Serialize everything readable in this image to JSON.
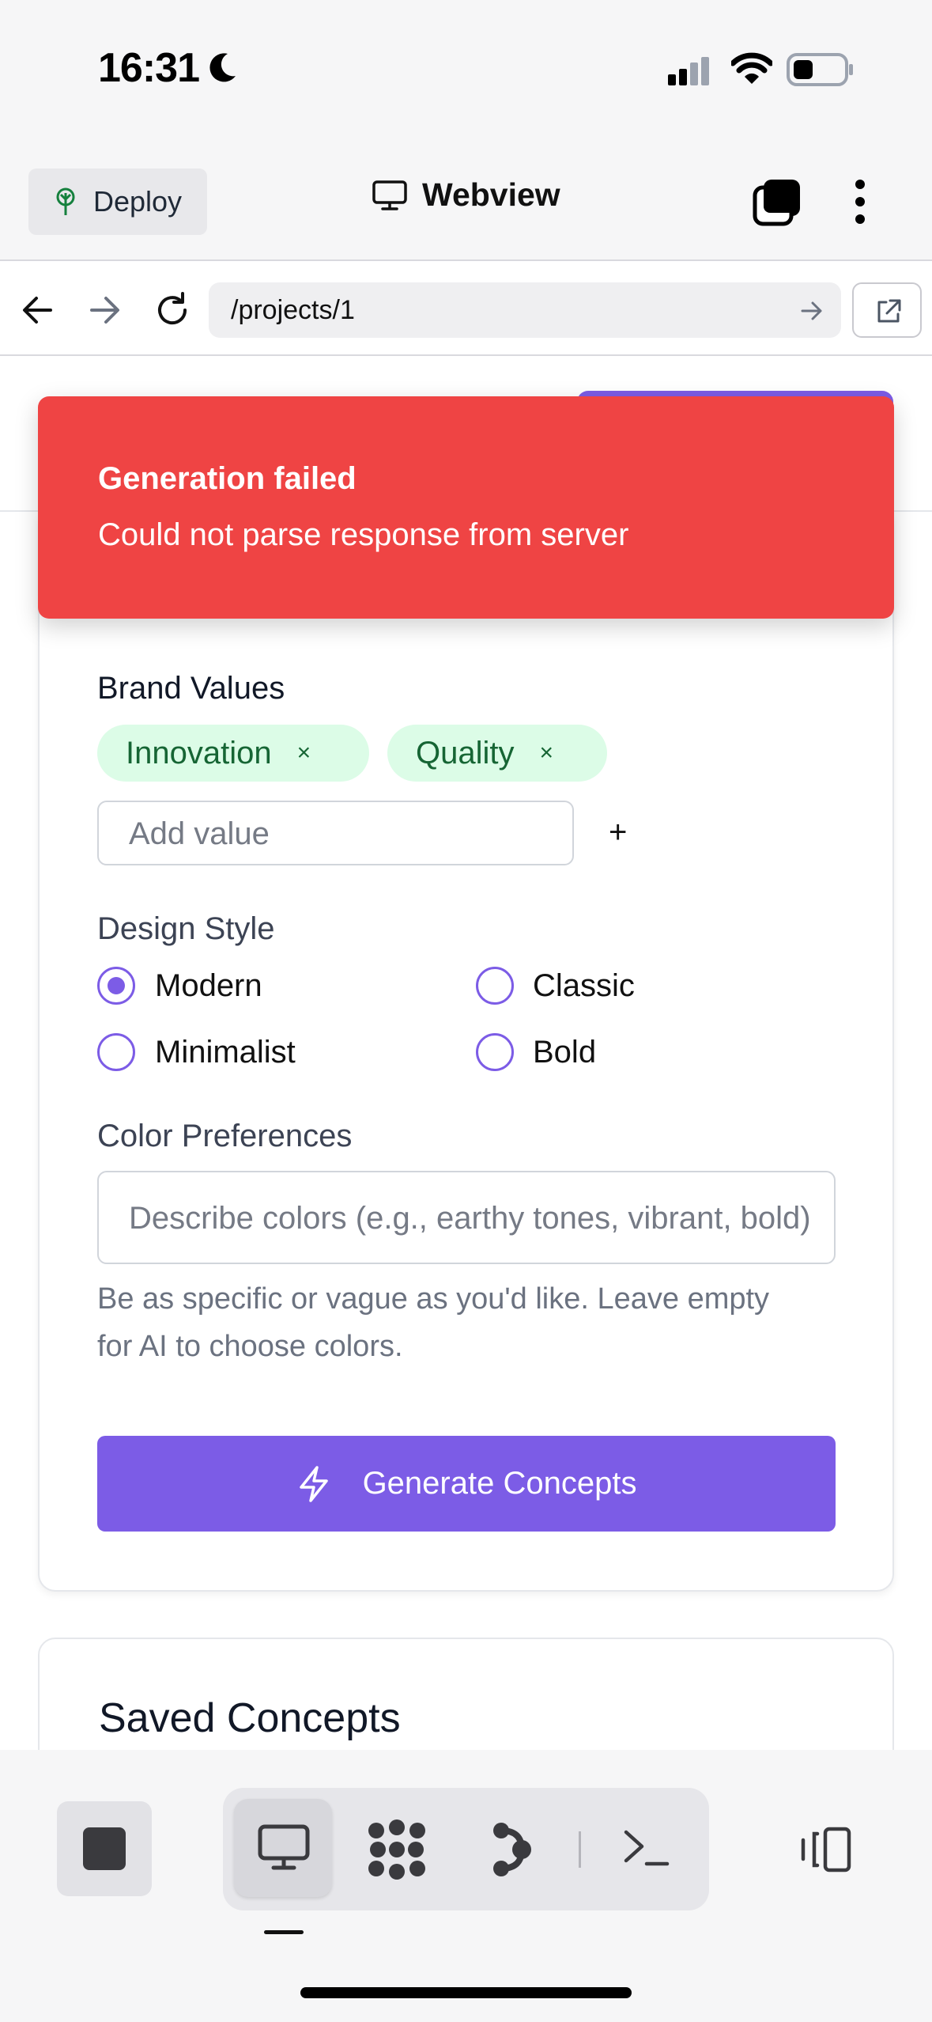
{
  "status_bar": {
    "time": "16:31"
  },
  "top_bar": {
    "deploy_label": "Deploy",
    "title": "Webview"
  },
  "url_bar": {
    "url": "/projects/1"
  },
  "toast": {
    "title": "Generation failed",
    "message": "Could not parse response from server"
  },
  "form": {
    "brand_values_label": "Brand Values",
    "values": [
      "Innovation",
      "Quality"
    ],
    "chip_remove_glyph": "×",
    "add_value_placeholder": "Add value",
    "add_button": "+",
    "design_style_label": "Design Style",
    "styles": [
      {
        "label": "Modern",
        "selected": true
      },
      {
        "label": "Classic",
        "selected": false
      },
      {
        "label": "Minimalist",
        "selected": false
      },
      {
        "label": "Bold",
        "selected": false
      }
    ],
    "color_label": "Color Preferences",
    "color_placeholder": "Describe colors (e.g., earthy tones, vibrant, bold)",
    "color_help": "Be as specific or vague as you'd like. Leave empty for AI to choose colors.",
    "generate_label": "Generate Concepts"
  },
  "saved": {
    "title": "Saved Concepts"
  },
  "colors": {
    "accent": "#7c5ce6",
    "error": "#ef4444",
    "chip_bg": "#dcfce7",
    "chip_text": "#166534"
  }
}
